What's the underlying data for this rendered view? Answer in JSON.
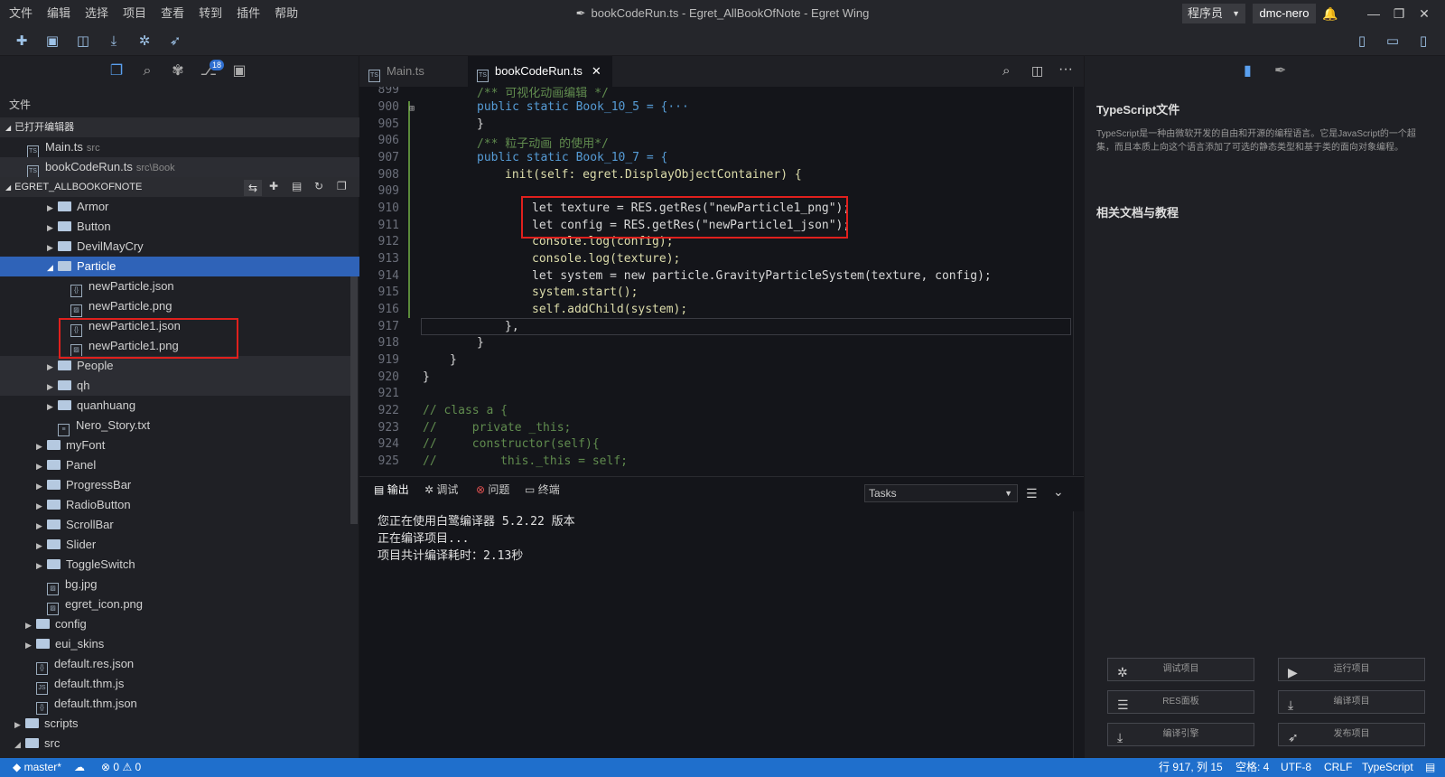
{
  "menu": [
    "文件",
    "编辑",
    "选择",
    "项目",
    "查看",
    "转到",
    "插件",
    "帮助"
  ],
  "window_title": "bookCodeRun.ts - Egret_AllBookOfNote - Egret Wing",
  "role_select": "程序员",
  "user": "dmc-nero",
  "badge": "18",
  "sidebar": {
    "title": "文件",
    "open_editors_label": "已打开编辑器",
    "open_editors": [
      {
        "name": "Main.ts",
        "path": "src"
      },
      {
        "name": "bookCodeRun.ts",
        "path": "src\\Book"
      }
    ],
    "project_label": "EGRET_ALLBOOKOFNOTE",
    "tree": [
      "Armor",
      "Button",
      "DevilMayCry",
      "Particle",
      "newParticle.json",
      "newParticle.png",
      "newParticle1.json",
      "newParticle1.png",
      "People",
      "qh",
      "quanhuang",
      "Nero_Story.txt",
      "myFont",
      "Panel",
      "ProgressBar",
      "RadioButton",
      "ScrollBar",
      "Slider",
      "ToggleSwitch",
      "bg.jpg",
      "egret_icon.png",
      "config",
      "eui_skins",
      "default.res.json",
      "default.thm.js",
      "default.thm.json",
      "scripts",
      "src"
    ]
  },
  "tabs": [
    {
      "label": "Main.ts"
    },
    {
      "label": "bookCodeRun.ts"
    }
  ],
  "code": {
    "line_numbers": [
      "899",
      "900",
      "905",
      "906",
      "907",
      "908",
      "909",
      "910",
      "911",
      "912",
      "913",
      "914",
      "915",
      "916",
      "917",
      "918",
      "919",
      "920",
      "921",
      "922",
      "923",
      "924",
      "925"
    ],
    "lines": [
      "/** 可视化动画编辑 */",
      "public static Book_10_5 = {···",
      "}",
      "/** 粒子动画 的使用*/",
      "public static Book_10_7 = {",
      "init(self: egret.DisplayObjectContainer) {",
      "",
      "let texture = RES.getRes(\"newParticle1_png\");",
      "let config = RES.getRes(\"newParticle1_json\");",
      "console.log(config);",
      "console.log(texture);",
      "let system = new particle.GravityParticleSystem(texture, config);",
      "system.start();",
      "self.addChild(system);",
      "},",
      "}",
      "}",
      "}",
      "",
      "// class a {",
      "//     private _this;",
      "//     constructor(self){",
      "//         this._this = self;"
    ]
  },
  "panel": {
    "tabs": [
      "输出",
      "调试",
      "问题",
      "终端"
    ],
    "select": "Tasks",
    "output": [
      "您正在使用白鹭编译器 5.2.22 版本",
      "正在编译项目...",
      "项目共计编译耗时：2.13秒"
    ]
  },
  "right": {
    "heading": "TypeScript文件",
    "description_1": "TypeScript是一种由微软开发的自由和开源的编程语言。它是JavaScript的一个超",
    "description_2": "集，而且本质上向这个语言添加了可选的静态类型和基于类的面向对象编程。",
    "docs_heading": "相关文档与教程",
    "buttons": [
      "调试项目",
      "运行项目",
      "RES面板",
      "编译项目",
      "编译引擎",
      "发布项目"
    ]
  },
  "status": {
    "branch": "master*",
    "errors": "0",
    "warnings": "0",
    "position": "行 917, 列 15",
    "spaces": "空格: 4",
    "encoding": "UTF-8",
    "eol": "CRLF",
    "language": "TypeScript"
  },
  "colors": {
    "accent": "#1f6fcc",
    "selection": "#2f63b8",
    "highlight_box": "#e0201d"
  }
}
